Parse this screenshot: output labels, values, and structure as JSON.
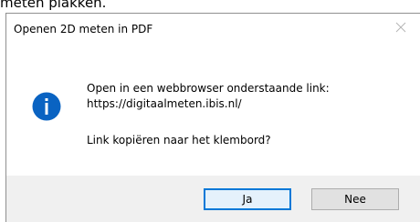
{
  "background_text": "meten plakken.",
  "dialog": {
    "title": "Openen 2D meten in PDF",
    "close_icon": "close-icon",
    "info_icon": "info-icon",
    "colors": {
      "info_blue": "#0a63c2",
      "accent": "#0078d7"
    },
    "message": {
      "line1": "Open in een webbrowser onderstaande link:",
      "line2": "https://digitaalmeten.ibis.nl/",
      "line3": "Link kopiëren naar het klembord?"
    },
    "buttons": {
      "yes": "Ja",
      "no": "Nee"
    }
  }
}
